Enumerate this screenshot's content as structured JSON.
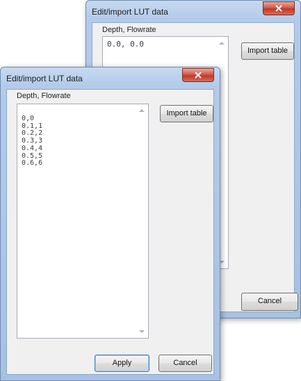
{
  "back_dialog": {
    "title": "Edit/import LUT data",
    "column_label": "Depth, Flowrate",
    "table_text": "0.0, 0.0",
    "import_label": "Import table",
    "apply_label": "",
    "cancel_label": "Cancel"
  },
  "front_dialog": {
    "title": "Edit/import LUT data",
    "column_label": "Depth, Flowrate",
    "table_text": "0,0\n0.1,1\n0.2,2\n0.3,3\n0.4,4\n0.5,5\n0.6,6",
    "import_label": "Import table",
    "apply_label": "Apply",
    "cancel_label": "Cancel"
  },
  "icons": {
    "close": "close-icon",
    "scroll_up": "scroll-up-arrow-icon",
    "scroll_down": "scroll-down-arrow-icon"
  },
  "colors": {
    "window_frame": "#b3cbe9",
    "close_button": "#c0392b",
    "dialog_body": "#f0f0f0"
  }
}
